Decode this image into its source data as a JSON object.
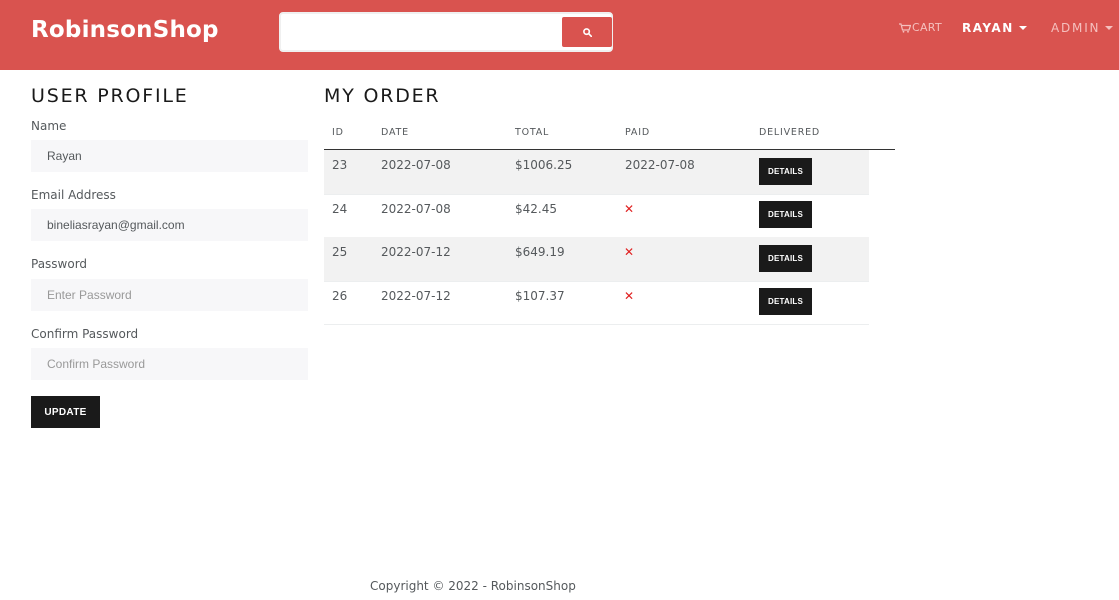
{
  "navbar": {
    "brand": "RobinsonShop",
    "search": {
      "value": "",
      "placeholder": "",
      "button_icon": "search-icon"
    },
    "cart": {
      "label": "CART",
      "icon": "cart-icon"
    },
    "user": {
      "label": "RAYAN"
    },
    "admin": {
      "label": "ADMIN"
    },
    "colors": {
      "primary": "#d9534f",
      "dark": "#1a1a1a",
      "danger_x": "#e02020"
    }
  },
  "profile": {
    "title": "USER PROFILE",
    "name_label": "Name",
    "name_value": "Rayan",
    "email_label": "Email Address",
    "email_value": "bineliasrayan@gmail.com",
    "password_label": "Password",
    "password_placeholder": "Enter Password",
    "confirm_label": "Confirm Password",
    "confirm_placeholder": "Confirm Password",
    "update_label": "UPDATE"
  },
  "orders": {
    "title": "MY ORDER",
    "columns": [
      "ID",
      "DATE",
      "TOTAL",
      "PAID",
      "DELIVERED"
    ],
    "rows": [
      {
        "id": "23",
        "date": "2022-07-08",
        "total": "$1006.25",
        "paid": "2022-07-08",
        "details": "DETAILS"
      },
      {
        "id": "24",
        "date": "2022-07-08",
        "total": "$42.45",
        "paid": "✕",
        "details": "DETAILS"
      },
      {
        "id": "25",
        "date": "2022-07-12",
        "total": "$649.19",
        "paid": "✕",
        "details": "DETAILS"
      },
      {
        "id": "26",
        "date": "2022-07-12",
        "total": "$107.37",
        "paid": "✕",
        "details": "DETAILS"
      }
    ]
  },
  "footer": {
    "text": "Copyright © 2022 - RobinsonShop"
  }
}
